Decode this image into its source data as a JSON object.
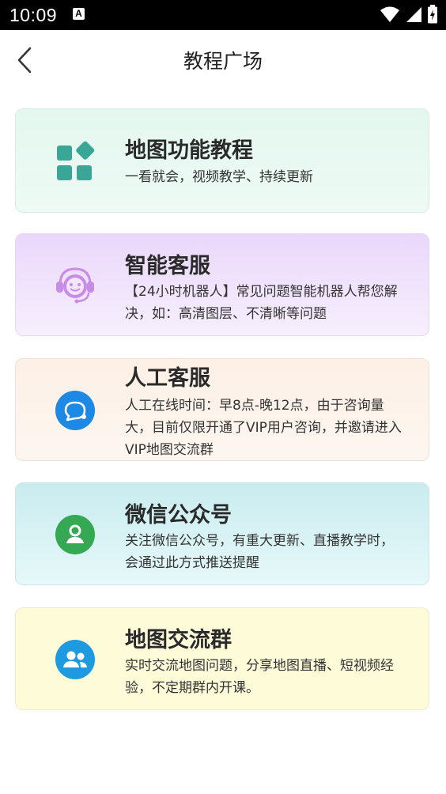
{
  "status_bar": {
    "time": "10:09",
    "notification_icon": "A"
  },
  "header": {
    "title": "教程广场"
  },
  "cards": [
    {
      "title": "地图功能教程",
      "desc": "一看就会，视频教学、持续更新",
      "icon": "apps-grid-icon",
      "accent": "#3aa796"
    },
    {
      "title": "智能客服",
      "desc": "【24小时机器人】常见问题智能机器人帮您解决，如：高清图层、不清晰等问题",
      "icon": "robot-headset-icon",
      "accent": "#c68ce8"
    },
    {
      "title": "人工客服",
      "desc": "人工在线时间：早8点-晚12点，由于咨询量大，目前仅限开通了VIP用户咨询，并邀请进入VIP地图交流群",
      "icon": "chat-bubble-icon",
      "accent": "#1e88e5"
    },
    {
      "title": "微信公众号",
      "desc": "关注微信公众号，有重大更新、直播教学时，会通过此方式推送提醒",
      "icon": "person-icon",
      "accent": "#34a853"
    },
    {
      "title": "地图交流群",
      "desc": "实时交流地图问题，分享地图直播、短视频经验，不定期群内开课。",
      "icon": "group-icon",
      "accent": "#1e9be0"
    }
  ]
}
